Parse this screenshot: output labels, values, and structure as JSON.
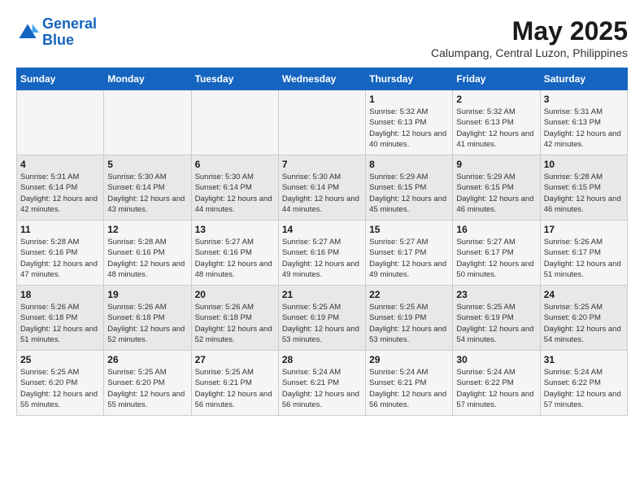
{
  "header": {
    "logo_line1": "General",
    "logo_line2": "Blue",
    "month": "May 2025",
    "location": "Calumpang, Central Luzon, Philippines"
  },
  "days_of_week": [
    "Sunday",
    "Monday",
    "Tuesday",
    "Wednesday",
    "Thursday",
    "Friday",
    "Saturday"
  ],
  "weeks": [
    [
      {
        "day": "",
        "info": ""
      },
      {
        "day": "",
        "info": ""
      },
      {
        "day": "",
        "info": ""
      },
      {
        "day": "",
        "info": ""
      },
      {
        "day": "1",
        "info": "Sunrise: 5:32 AM\nSunset: 6:13 PM\nDaylight: 12 hours\nand 40 minutes."
      },
      {
        "day": "2",
        "info": "Sunrise: 5:32 AM\nSunset: 6:13 PM\nDaylight: 12 hours\nand 41 minutes."
      },
      {
        "day": "3",
        "info": "Sunrise: 5:31 AM\nSunset: 6:13 PM\nDaylight: 12 hours\nand 42 minutes."
      }
    ],
    [
      {
        "day": "4",
        "info": "Sunrise: 5:31 AM\nSunset: 6:14 PM\nDaylight: 12 hours\nand 42 minutes."
      },
      {
        "day": "5",
        "info": "Sunrise: 5:30 AM\nSunset: 6:14 PM\nDaylight: 12 hours\nand 43 minutes."
      },
      {
        "day": "6",
        "info": "Sunrise: 5:30 AM\nSunset: 6:14 PM\nDaylight: 12 hours\nand 44 minutes."
      },
      {
        "day": "7",
        "info": "Sunrise: 5:30 AM\nSunset: 6:14 PM\nDaylight: 12 hours\nand 44 minutes."
      },
      {
        "day": "8",
        "info": "Sunrise: 5:29 AM\nSunset: 6:15 PM\nDaylight: 12 hours\nand 45 minutes."
      },
      {
        "day": "9",
        "info": "Sunrise: 5:29 AM\nSunset: 6:15 PM\nDaylight: 12 hours\nand 46 minutes."
      },
      {
        "day": "10",
        "info": "Sunrise: 5:28 AM\nSunset: 6:15 PM\nDaylight: 12 hours\nand 46 minutes."
      }
    ],
    [
      {
        "day": "11",
        "info": "Sunrise: 5:28 AM\nSunset: 6:16 PM\nDaylight: 12 hours\nand 47 minutes."
      },
      {
        "day": "12",
        "info": "Sunrise: 5:28 AM\nSunset: 6:16 PM\nDaylight: 12 hours\nand 48 minutes."
      },
      {
        "day": "13",
        "info": "Sunrise: 5:27 AM\nSunset: 6:16 PM\nDaylight: 12 hours\nand 48 minutes."
      },
      {
        "day": "14",
        "info": "Sunrise: 5:27 AM\nSunset: 6:16 PM\nDaylight: 12 hours\nand 49 minutes."
      },
      {
        "day": "15",
        "info": "Sunrise: 5:27 AM\nSunset: 6:17 PM\nDaylight: 12 hours\nand 49 minutes."
      },
      {
        "day": "16",
        "info": "Sunrise: 5:27 AM\nSunset: 6:17 PM\nDaylight: 12 hours\nand 50 minutes."
      },
      {
        "day": "17",
        "info": "Sunrise: 5:26 AM\nSunset: 6:17 PM\nDaylight: 12 hours\nand 51 minutes."
      }
    ],
    [
      {
        "day": "18",
        "info": "Sunrise: 5:26 AM\nSunset: 6:18 PM\nDaylight: 12 hours\nand 51 minutes."
      },
      {
        "day": "19",
        "info": "Sunrise: 5:26 AM\nSunset: 6:18 PM\nDaylight: 12 hours\nand 52 minutes."
      },
      {
        "day": "20",
        "info": "Sunrise: 5:26 AM\nSunset: 6:18 PM\nDaylight: 12 hours\nand 52 minutes."
      },
      {
        "day": "21",
        "info": "Sunrise: 5:25 AM\nSunset: 6:19 PM\nDaylight: 12 hours\nand 53 minutes."
      },
      {
        "day": "22",
        "info": "Sunrise: 5:25 AM\nSunset: 6:19 PM\nDaylight: 12 hours\nand 53 minutes."
      },
      {
        "day": "23",
        "info": "Sunrise: 5:25 AM\nSunset: 6:19 PM\nDaylight: 12 hours\nand 54 minutes."
      },
      {
        "day": "24",
        "info": "Sunrise: 5:25 AM\nSunset: 6:20 PM\nDaylight: 12 hours\nand 54 minutes."
      }
    ],
    [
      {
        "day": "25",
        "info": "Sunrise: 5:25 AM\nSunset: 6:20 PM\nDaylight: 12 hours\nand 55 minutes."
      },
      {
        "day": "26",
        "info": "Sunrise: 5:25 AM\nSunset: 6:20 PM\nDaylight: 12 hours\nand 55 minutes."
      },
      {
        "day": "27",
        "info": "Sunrise: 5:25 AM\nSunset: 6:21 PM\nDaylight: 12 hours\nand 56 minutes."
      },
      {
        "day": "28",
        "info": "Sunrise: 5:24 AM\nSunset: 6:21 PM\nDaylight: 12 hours\nand 56 minutes."
      },
      {
        "day": "29",
        "info": "Sunrise: 5:24 AM\nSunset: 6:21 PM\nDaylight: 12 hours\nand 56 minutes."
      },
      {
        "day": "30",
        "info": "Sunrise: 5:24 AM\nSunset: 6:22 PM\nDaylight: 12 hours\nand 57 minutes."
      },
      {
        "day": "31",
        "info": "Sunrise: 5:24 AM\nSunset: 6:22 PM\nDaylight: 12 hours\nand 57 minutes."
      }
    ]
  ]
}
